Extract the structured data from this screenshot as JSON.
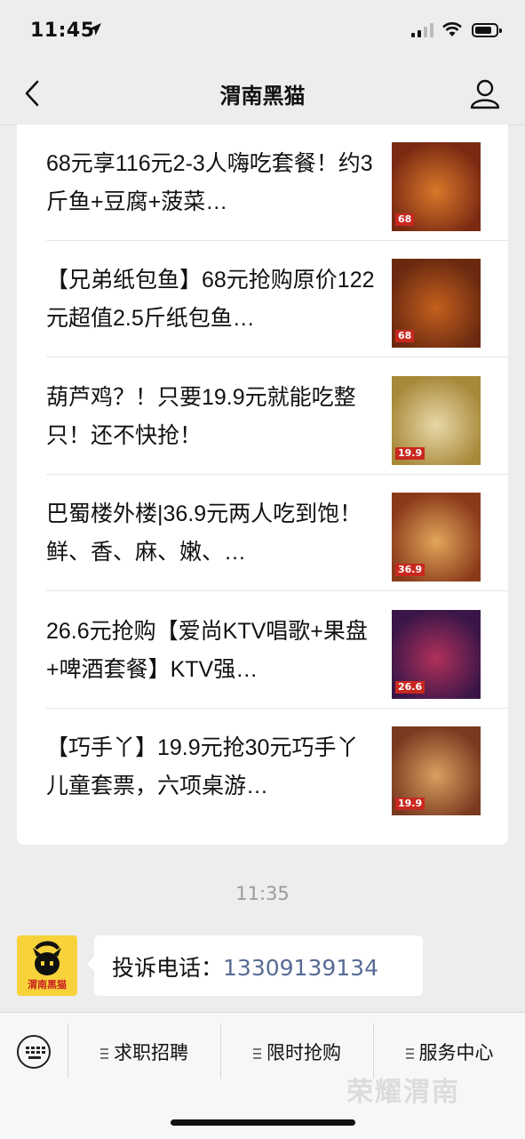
{
  "status_bar": {
    "time": "11:45"
  },
  "nav": {
    "title": "渭南黑猫"
  },
  "articles": [
    {
      "title": "68元享116元2-3人嗨吃套餐！约3斤鱼+豆腐+菠菜…",
      "thumb_price": "68",
      "thumb_colors": [
        "#7a2a12",
        "#d9782a"
      ]
    },
    {
      "title": "【兄弟纸包鱼】68元抢购原价122元超值2.5斤纸包鱼…",
      "thumb_price": "68",
      "thumb_colors": [
        "#6b2a10",
        "#c4601e"
      ]
    },
    {
      "title": "葫芦鸡？！只要19.9元就能吃整只！还不快抢！",
      "thumb_price": "19.9",
      "thumb_colors": [
        "#a8893a",
        "#e8d8a8"
      ]
    },
    {
      "title": "巴蜀楼外楼|36.9元两人吃到饱！鲜、香、麻、嫩、…",
      "thumb_price": "36.9",
      "thumb_colors": [
        "#8a3a1a",
        "#e3a65a"
      ]
    },
    {
      "title": "26.6元抢购【爱尚KTV唱歌+果盘+啤酒套餐】KTV强…",
      "thumb_price": "26.6",
      "thumb_colors": [
        "#3a1648",
        "#b0305a"
      ]
    },
    {
      "title": "【巧手丫】19.9元抢30元巧手丫儿童套票，六项桌游…",
      "thumb_price": "19.9",
      "thumb_colors": [
        "#7a3a20",
        "#d8a060"
      ]
    }
  ],
  "chat": {
    "timestamp": "11:35",
    "avatar_text": "渭南黑猫",
    "message_label": "投诉电话：",
    "message_phone": "13309139134"
  },
  "menu": {
    "tabs": [
      {
        "label": "求职招聘"
      },
      {
        "label": "限时抢购"
      },
      {
        "label": "服务中心"
      }
    ]
  },
  "watermark": "荣耀渭南"
}
